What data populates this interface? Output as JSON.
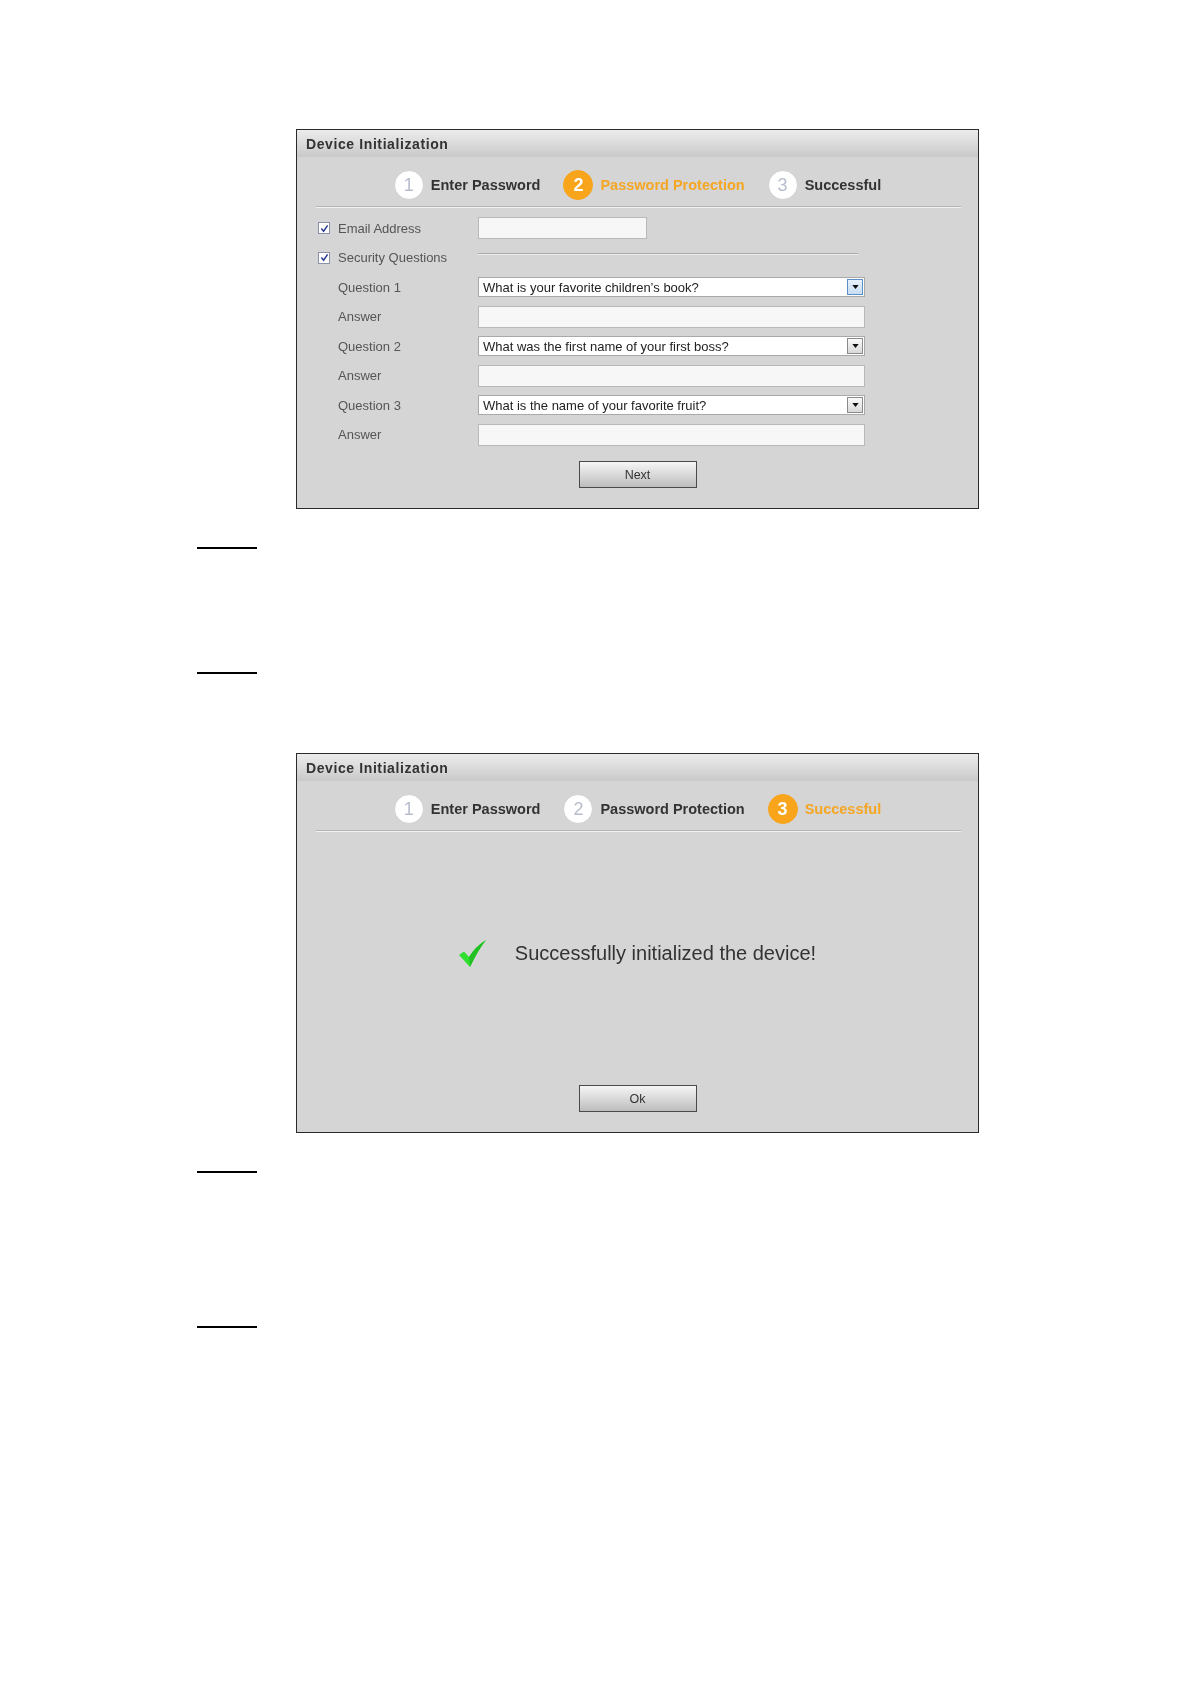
{
  "dialogs": [
    {
      "kind": "form",
      "title": "Device Initialization",
      "steps": [
        {
          "number": "1",
          "label": "Enter Password",
          "selected": false
        },
        {
          "number": "2",
          "label": "Password Protection",
          "selected": true
        },
        {
          "number": "3",
          "label": "Successful",
          "selected": false
        }
      ],
      "email": {
        "label": "Email Address",
        "checked": true
      },
      "security_questions": {
        "label": "Security Questions",
        "checked": true
      },
      "questions": [
        {
          "label": "Question 1",
          "value": "What is your favorite children’s book?",
          "focused": true,
          "answer_label": "Answer"
        },
        {
          "label": "Question 2",
          "value": "What was the first name of your first boss?",
          "focused": false,
          "answer_label": "Answer"
        },
        {
          "label": "Question 3",
          "value": "What is the name of your favorite fruit?",
          "focused": false,
          "answer_label": "Answer"
        }
      ],
      "button": "Next"
    },
    {
      "kind": "message",
      "title": "Device Initialization",
      "steps": [
        {
          "number": "1",
          "label": "Enter Password",
          "selected": false
        },
        {
          "number": "2",
          "label": "Password Protection",
          "selected": false
        },
        {
          "number": "3",
          "label": "Successful",
          "selected": true
        }
      ],
      "message": "Successfully initialized the device!",
      "button": "Ok"
    }
  ]
}
